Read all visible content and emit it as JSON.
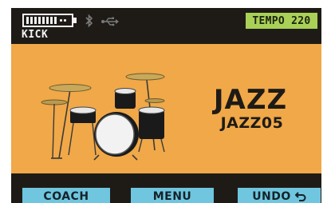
{
  "status_bar": {
    "battery_icon": "battery-icon",
    "bluetooth_icon": "bluetooth-icon",
    "usb_icon": "usb-icon",
    "preset_label": "KICK",
    "tempo_label": "TEMPO 220"
  },
  "main": {
    "image_icon": "drum-kit-icon",
    "kit_name": "JAZZ",
    "kit_preset": "JAZZ05"
  },
  "softkeys": {
    "coach": "COACH",
    "menu": "MENU",
    "undo": "UNDO",
    "undo_icon": "undo-arrow-icon"
  },
  "colors": {
    "screen_bg": "#1e1b17",
    "panel_orange": "#f0a848",
    "tempo_green": "#a9d157",
    "softkey_blue": "#6fc6de"
  }
}
